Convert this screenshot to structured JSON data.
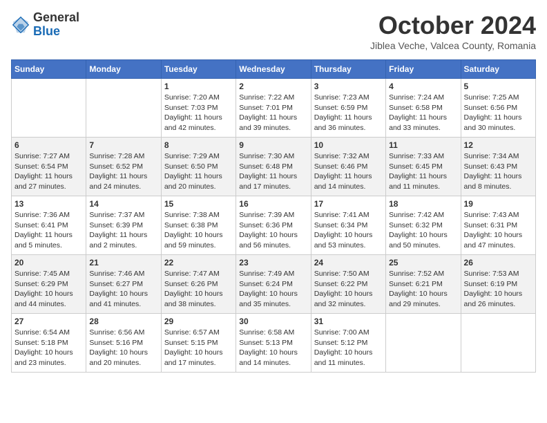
{
  "header": {
    "logo_general": "General",
    "logo_blue": "Blue",
    "month_title": "October 2024",
    "location": "Jiblea Veche, Valcea County, Romania"
  },
  "days_of_week": [
    "Sunday",
    "Monday",
    "Tuesday",
    "Wednesday",
    "Thursday",
    "Friday",
    "Saturday"
  ],
  "weeks": [
    [
      {
        "num": "",
        "info": ""
      },
      {
        "num": "",
        "info": ""
      },
      {
        "num": "1",
        "info": "Sunrise: 7:20 AM\nSunset: 7:03 PM\nDaylight: 11 hours and 42 minutes."
      },
      {
        "num": "2",
        "info": "Sunrise: 7:22 AM\nSunset: 7:01 PM\nDaylight: 11 hours and 39 minutes."
      },
      {
        "num": "3",
        "info": "Sunrise: 7:23 AM\nSunset: 6:59 PM\nDaylight: 11 hours and 36 minutes."
      },
      {
        "num": "4",
        "info": "Sunrise: 7:24 AM\nSunset: 6:58 PM\nDaylight: 11 hours and 33 minutes."
      },
      {
        "num": "5",
        "info": "Sunrise: 7:25 AM\nSunset: 6:56 PM\nDaylight: 11 hours and 30 minutes."
      }
    ],
    [
      {
        "num": "6",
        "info": "Sunrise: 7:27 AM\nSunset: 6:54 PM\nDaylight: 11 hours and 27 minutes."
      },
      {
        "num": "7",
        "info": "Sunrise: 7:28 AM\nSunset: 6:52 PM\nDaylight: 11 hours and 24 minutes."
      },
      {
        "num": "8",
        "info": "Sunrise: 7:29 AM\nSunset: 6:50 PM\nDaylight: 11 hours and 20 minutes."
      },
      {
        "num": "9",
        "info": "Sunrise: 7:30 AM\nSunset: 6:48 PM\nDaylight: 11 hours and 17 minutes."
      },
      {
        "num": "10",
        "info": "Sunrise: 7:32 AM\nSunset: 6:46 PM\nDaylight: 11 hours and 14 minutes."
      },
      {
        "num": "11",
        "info": "Sunrise: 7:33 AM\nSunset: 6:45 PM\nDaylight: 11 hours and 11 minutes."
      },
      {
        "num": "12",
        "info": "Sunrise: 7:34 AM\nSunset: 6:43 PM\nDaylight: 11 hours and 8 minutes."
      }
    ],
    [
      {
        "num": "13",
        "info": "Sunrise: 7:36 AM\nSunset: 6:41 PM\nDaylight: 11 hours and 5 minutes."
      },
      {
        "num": "14",
        "info": "Sunrise: 7:37 AM\nSunset: 6:39 PM\nDaylight: 11 hours and 2 minutes."
      },
      {
        "num": "15",
        "info": "Sunrise: 7:38 AM\nSunset: 6:38 PM\nDaylight: 10 hours and 59 minutes."
      },
      {
        "num": "16",
        "info": "Sunrise: 7:39 AM\nSunset: 6:36 PM\nDaylight: 10 hours and 56 minutes."
      },
      {
        "num": "17",
        "info": "Sunrise: 7:41 AM\nSunset: 6:34 PM\nDaylight: 10 hours and 53 minutes."
      },
      {
        "num": "18",
        "info": "Sunrise: 7:42 AM\nSunset: 6:32 PM\nDaylight: 10 hours and 50 minutes."
      },
      {
        "num": "19",
        "info": "Sunrise: 7:43 AM\nSunset: 6:31 PM\nDaylight: 10 hours and 47 minutes."
      }
    ],
    [
      {
        "num": "20",
        "info": "Sunrise: 7:45 AM\nSunset: 6:29 PM\nDaylight: 10 hours and 44 minutes."
      },
      {
        "num": "21",
        "info": "Sunrise: 7:46 AM\nSunset: 6:27 PM\nDaylight: 10 hours and 41 minutes."
      },
      {
        "num": "22",
        "info": "Sunrise: 7:47 AM\nSunset: 6:26 PM\nDaylight: 10 hours and 38 minutes."
      },
      {
        "num": "23",
        "info": "Sunrise: 7:49 AM\nSunset: 6:24 PM\nDaylight: 10 hours and 35 minutes."
      },
      {
        "num": "24",
        "info": "Sunrise: 7:50 AM\nSunset: 6:22 PM\nDaylight: 10 hours and 32 minutes."
      },
      {
        "num": "25",
        "info": "Sunrise: 7:52 AM\nSunset: 6:21 PM\nDaylight: 10 hours and 29 minutes."
      },
      {
        "num": "26",
        "info": "Sunrise: 7:53 AM\nSunset: 6:19 PM\nDaylight: 10 hours and 26 minutes."
      }
    ],
    [
      {
        "num": "27",
        "info": "Sunrise: 6:54 AM\nSunset: 5:18 PM\nDaylight: 10 hours and 23 minutes."
      },
      {
        "num": "28",
        "info": "Sunrise: 6:56 AM\nSunset: 5:16 PM\nDaylight: 10 hours and 20 minutes."
      },
      {
        "num": "29",
        "info": "Sunrise: 6:57 AM\nSunset: 5:15 PM\nDaylight: 10 hours and 17 minutes."
      },
      {
        "num": "30",
        "info": "Sunrise: 6:58 AM\nSunset: 5:13 PM\nDaylight: 10 hours and 14 minutes."
      },
      {
        "num": "31",
        "info": "Sunrise: 7:00 AM\nSunset: 5:12 PM\nDaylight: 10 hours and 11 minutes."
      },
      {
        "num": "",
        "info": ""
      },
      {
        "num": "",
        "info": ""
      }
    ]
  ]
}
